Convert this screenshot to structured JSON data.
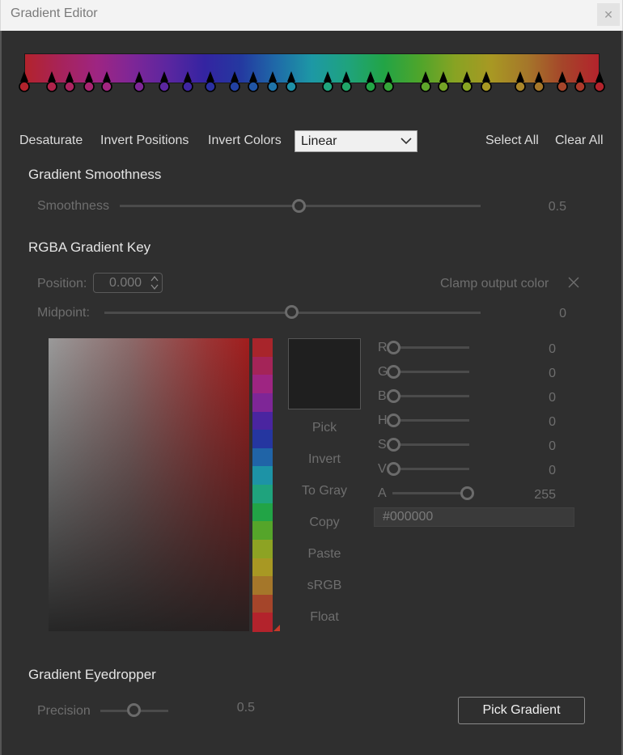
{
  "window": {
    "title": "Gradient Editor",
    "close_glyph": "✕"
  },
  "gradient": {
    "colors": [
      "#b3232c",
      "#a7235a",
      "#9e2582",
      "#7e2697",
      "#5b26a0",
      "#3424a1",
      "#2438a0",
      "#1f6aa8",
      "#1d98a5",
      "#1fa37d",
      "#22a446",
      "#4ea52b",
      "#88a323",
      "#a89823",
      "#a5772a",
      "#a5452a",
      "#b3232c"
    ],
    "stops": [
      {
        "pos": 0.0,
        "color": "#b3232c"
      },
      {
        "pos": 0.048,
        "color": "#b0234a"
      },
      {
        "pos": 0.079,
        "color": "#ac2460"
      },
      {
        "pos": 0.112,
        "color": "#a82470"
      },
      {
        "pos": 0.143,
        "color": "#a22580"
      },
      {
        "pos": 0.2,
        "color": "#7e2697"
      },
      {
        "pos": 0.244,
        "color": "#5b26a0"
      },
      {
        "pos": 0.284,
        "color": "#3e25a1"
      },
      {
        "pos": 0.324,
        "color": "#2a30a1"
      },
      {
        "pos": 0.366,
        "color": "#2240a2"
      },
      {
        "pos": 0.398,
        "color": "#2055a5"
      },
      {
        "pos": 0.432,
        "color": "#1f74a8"
      },
      {
        "pos": 0.464,
        "color": "#1e90a7"
      },
      {
        "pos": 0.527,
        "color": "#1fa37d"
      },
      {
        "pos": 0.56,
        "color": "#20a468"
      },
      {
        "pos": 0.602,
        "color": "#22a446"
      },
      {
        "pos": 0.633,
        "color": "#35a538"
      },
      {
        "pos": 0.697,
        "color": "#5ea52a"
      },
      {
        "pos": 0.729,
        "color": "#75a426"
      },
      {
        "pos": 0.769,
        "color": "#88a323"
      },
      {
        "pos": 0.803,
        "color": "#a89823"
      },
      {
        "pos": 0.862,
        "color": "#a9862a"
      },
      {
        "pos": 0.895,
        "color": "#a5772a"
      },
      {
        "pos": 0.936,
        "color": "#a5452a"
      },
      {
        "pos": 0.966,
        "color": "#ab3a2b"
      },
      {
        "pos": 1.0,
        "color": "#b3232c"
      }
    ]
  },
  "toolbar": {
    "desaturate": "Desaturate",
    "invert_positions": "Invert Positions",
    "invert_colors": "Invert Colors",
    "mode": "Linear",
    "select_all": "Select All",
    "clear_all": "Clear All"
  },
  "smoothness": {
    "heading": "Gradient Smoothness",
    "label": "Smoothness",
    "value": "0.5",
    "fraction": 0.5
  },
  "key": {
    "heading": "RGBA Gradient Key",
    "position_label": "Position:",
    "position_value": "0.000",
    "clamp_label": "Clamp output color",
    "midpoint_label": "Midpoint:",
    "midpoint_value": "0",
    "midpoint_fraction": 0.5
  },
  "picker": {
    "swatch_color": "#1f1f1f",
    "buttons": [
      "Pick",
      "Invert",
      "To Gray",
      "Copy",
      "Paste",
      "sRGB",
      "Float"
    ],
    "channels": [
      {
        "label": "R",
        "value": "0"
      },
      {
        "label": "G",
        "value": "0"
      },
      {
        "label": "B",
        "value": "0"
      },
      {
        "label": "H",
        "value": "0"
      },
      {
        "label": "S",
        "value": "0"
      },
      {
        "label": "V",
        "value": "0"
      }
    ],
    "alpha": {
      "label": "A",
      "value": "255"
    },
    "hex": "#000000",
    "hue_strip": [
      "#a8252b",
      "#a42458",
      "#9e2582",
      "#7e2697",
      "#4a25a0",
      "#2536a0",
      "#2064a7",
      "#1d93a6",
      "#1fa37d",
      "#22a446",
      "#55a52a",
      "#8da323",
      "#a89823",
      "#a5772a",
      "#a5452a",
      "#b3232c"
    ]
  },
  "eyedropper": {
    "heading": "Gradient Eyedropper",
    "precision_label": "Precision",
    "precision_value": "0.5",
    "precision_fraction": 0.5,
    "pick_button": "Pick Gradient"
  }
}
